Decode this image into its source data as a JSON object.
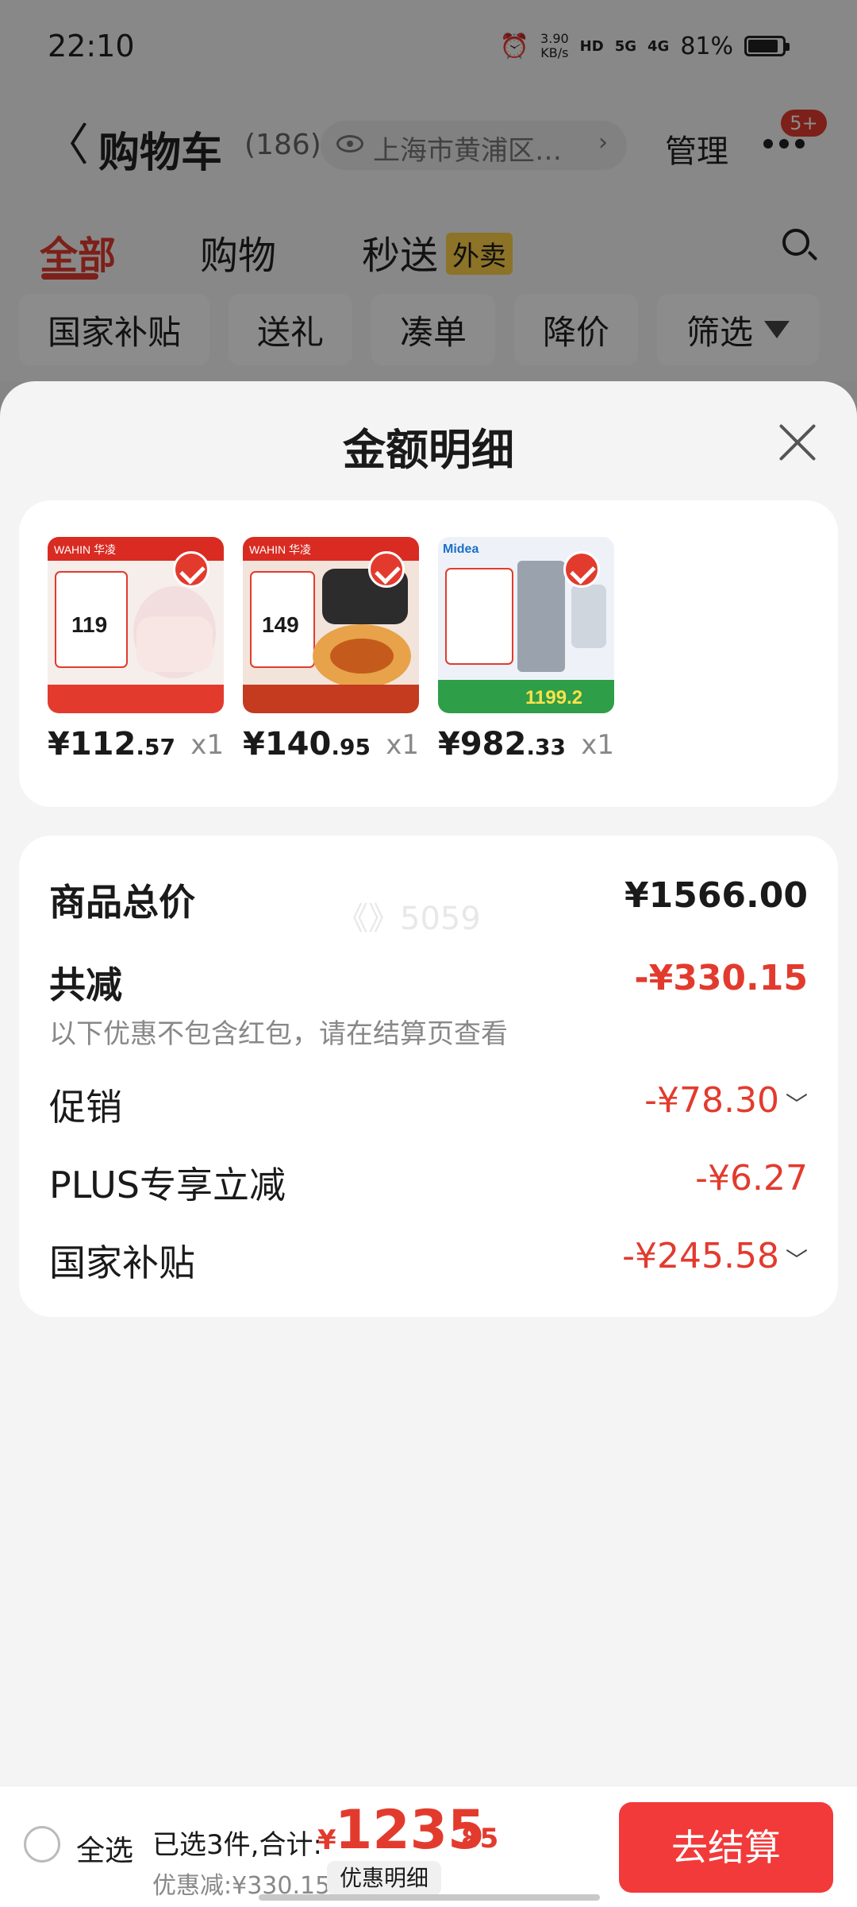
{
  "status_bar": {
    "time": "22:10",
    "net_speed_value": "3.90",
    "net_speed_unit": "KB/s",
    "hd": "HD",
    "sig1": "5G",
    "sig2": "4G",
    "battery": "81%"
  },
  "header": {
    "back": "〈",
    "title": "购物车",
    "count": "(186)",
    "address": "上海市黄浦区…",
    "address_chevron": "›",
    "manage": "管理",
    "badge": "5+"
  },
  "tabs": [
    {
      "label": "全部"
    },
    {
      "label": "购物"
    },
    {
      "label": "秒送",
      "badge": "外卖"
    }
  ],
  "filter_chips": [
    "国家补贴",
    "送礼",
    "凑单",
    "降价",
    "筛选"
  ],
  "sheet": {
    "title": "金额明细",
    "products": [
      {
        "price_int": "¥112",
        "price_dec": ".57",
        "qty": "x1",
        "brand": "WAHIN 华凌",
        "promo": "119",
        "color": "#f3ebe8"
      },
      {
        "price_int": "¥140",
        "price_dec": ".95",
        "qty": "x1",
        "brand": "WAHIN 华凌",
        "promo": "149",
        "color": "#f3e6de"
      },
      {
        "price_int": "¥982",
        "price_dec": ".33",
        "qty": "x1",
        "brand": "Midea",
        "promo": "1199.2",
        "color": "#e9eef6"
      }
    ],
    "summary": {
      "total_label": "商品总价",
      "total_value": "¥1566.00",
      "watermark": "《》5059",
      "reduction_label": "共减",
      "reduction_value": "-¥330.15",
      "reduction_note": "以下优惠不包含红包，请在结算页查看",
      "rows": [
        {
          "label": "促销",
          "value": "-¥78.30",
          "chevron": "﹀"
        },
        {
          "label": "PLUS专享立减",
          "value": "-¥6.27",
          "chevron": ""
        },
        {
          "label": "国家补贴",
          "value": "-¥245.58",
          "chevron": "﹀"
        }
      ]
    }
  },
  "bottom_bar": {
    "select_all": "全选",
    "selected_text": "已选3件,合计:",
    "total_symbol": "¥",
    "total_int": "1235",
    "total_dec": ".85",
    "discount_text": "优惠减:¥330.15",
    "detail_button": "优惠明细",
    "checkout_button": "去结算"
  },
  "colors": {
    "accent": "#e23b2e",
    "checkout": "#f23a3a",
    "sheet_bg": "#f4f4f4"
  }
}
